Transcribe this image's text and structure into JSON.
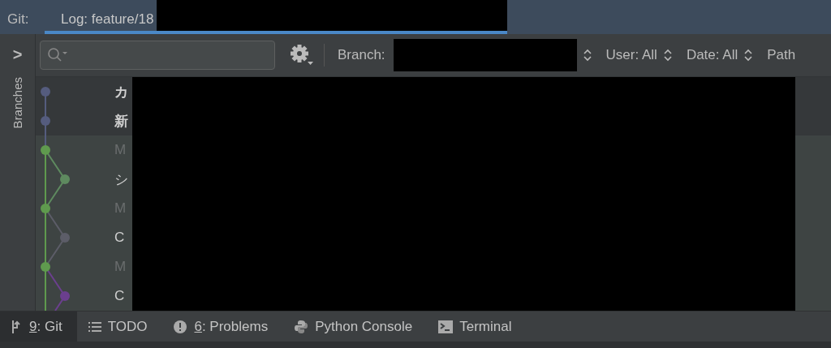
{
  "header": {
    "label": "Git:",
    "tabs": [
      {
        "label": "Log: feature/18",
        "selected": true
      }
    ]
  },
  "sidebar": {
    "label": "Branches",
    "expand": ">"
  },
  "toolbar": {
    "filters": [
      {
        "label": "Branch:",
        "kind": "redacted"
      },
      {
        "label": "User: All",
        "kind": "plain"
      },
      {
        "label": "Date: All",
        "kind": "plain"
      },
      {
        "label": "Path",
        "kind": "cut"
      }
    ]
  },
  "commits": [
    {
      "subject": "カ",
      "bold": true,
      "dimmed": false,
      "highlighted": false,
      "kind": "main",
      "color": "#555c7e"
    },
    {
      "subject": "新",
      "bold": true,
      "dimmed": false,
      "highlighted": false,
      "kind": "main",
      "color": "#555c7e"
    },
    {
      "subject": "M",
      "bold": false,
      "dimmed": true,
      "highlighted": true,
      "kind": "main",
      "color": "#5f9a4e"
    },
    {
      "subject": "シ",
      "bold": false,
      "dimmed": false,
      "highlighted": true,
      "kind": "side",
      "color": "#5e8a5f"
    },
    {
      "subject": "M",
      "bold": false,
      "dimmed": true,
      "highlighted": true,
      "kind": "main",
      "color": "#5f9a4e"
    },
    {
      "subject": "C",
      "bold": false,
      "dimmed": false,
      "highlighted": true,
      "kind": "side",
      "color": "#5c5d68"
    },
    {
      "subject": "M",
      "bold": false,
      "dimmed": true,
      "highlighted": true,
      "kind": "main",
      "color": "#5f9a4e"
    },
    {
      "subject": "C",
      "bold": false,
      "dimmed": false,
      "highlighted": true,
      "kind": "side",
      "color": "#6b3f8e"
    }
  ],
  "tool_tabs": [
    {
      "mnemonic": "9",
      "label": ": Git",
      "kind": "git",
      "selected": true
    },
    {
      "label": "TODO",
      "kind": "list",
      "selected": false
    },
    {
      "mnemonic": "6",
      "label": ": Problems",
      "kind": "alert",
      "selected": false
    },
    {
      "label": "Python Console",
      "kind": "python",
      "selected": false
    },
    {
      "label": "Terminal",
      "kind": "terminal",
      "selected": false
    }
  ]
}
